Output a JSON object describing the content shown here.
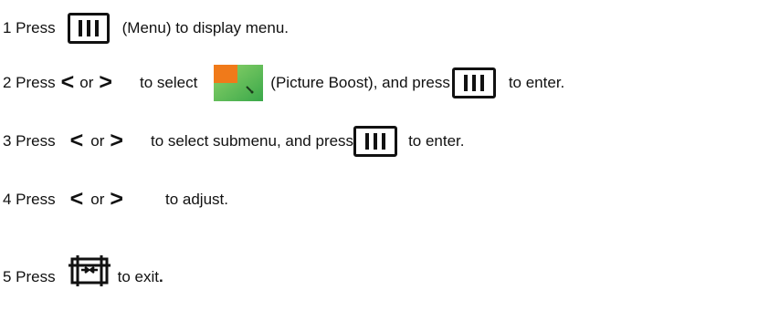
{
  "steps": [
    {
      "num": "1 Press",
      "icon1": "menu-key-icon",
      "after1": "(Menu) to display menu."
    },
    {
      "num": "2 Press",
      "lt": "<",
      "or": "or",
      "gt": ">",
      "mid": "to select",
      "icon_pb": "picture-boost-icon",
      "after_pb": "(Picture Boost), and press",
      "icon2": "menu-key-icon",
      "end": "to enter."
    },
    {
      "num": "3 Press",
      "lt": "<",
      "or": "or",
      "gt": ">",
      "mid": "to select submenu, and press",
      "icon2": "menu-key-icon",
      "end": "to enter."
    },
    {
      "num": "4 Press",
      "lt": "<",
      "or": "or",
      "gt": ">",
      "end": "to adjust."
    },
    {
      "num": "5 Press",
      "icon_exit": "exit-key-icon",
      "end": "to exit",
      "period": "."
    }
  ],
  "colors": {
    "text": "#111111",
    "pb_orange": "#f07a1a",
    "pb_green": "#5cc24a"
  }
}
